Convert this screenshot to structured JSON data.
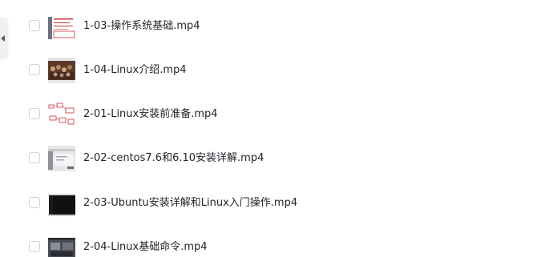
{
  "files": [
    {
      "name": "1-03-操作系统基础.mp4",
      "thumbnail_icon": "slide-thumbnail-icon"
    },
    {
      "name": "1-04-Linux介绍.mp4",
      "thumbnail_icon": "photo-thumbnail-icon"
    },
    {
      "name": "2-01-Linux安装前准备.mp4",
      "thumbnail_icon": "diagram-thumbnail-icon"
    },
    {
      "name": "2-02-centos7.6和6.10安装详解.mp4",
      "thumbnail_icon": "installer-thumbnail-icon"
    },
    {
      "name": "2-03-Ubuntu安装详解和Linux入门操作.mp4",
      "thumbnail_icon": "terminal-thumbnail-icon"
    },
    {
      "name": "2-04-Linux基础命令.mp4",
      "thumbnail_icon": "desktop-thumbnail-icon"
    }
  ],
  "colors": {
    "text": "#1f2329",
    "checkbox_border": "#cfd3da",
    "handle_bg": "#eef0f3",
    "accent_red": "#c8343a"
  }
}
